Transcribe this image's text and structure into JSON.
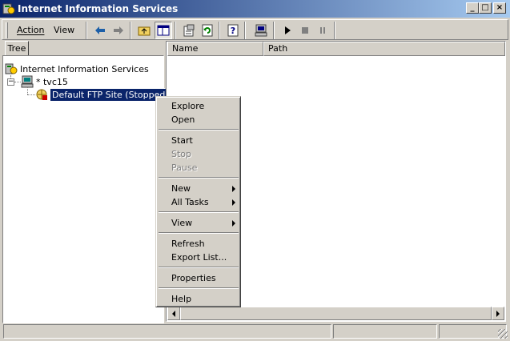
{
  "window": {
    "title": "Internet Information Services"
  },
  "caption_buttons": {
    "minimize": "_",
    "maximize": "□",
    "close": "×"
  },
  "menu": {
    "action": "Action",
    "view": "View"
  },
  "toolbar_icons": [
    "back-icon",
    "forward-icon",
    "up-folder-icon",
    "show-hide-tree-icon",
    "properties-icon",
    "refresh-icon",
    "help-icon",
    "computer-icon",
    "play-icon",
    "stop-icon",
    "pause-icon"
  ],
  "tree": {
    "tab_label": "Tree",
    "root_label": "Internet Information Services",
    "server_label": "* tvc15",
    "site_label": "Default FTP Site (Stopped)"
  },
  "list": {
    "columns": [
      "Name",
      "Path"
    ]
  },
  "context_menu": {
    "explore": "Explore",
    "open": "Open",
    "start": "Start",
    "stop": "Stop",
    "pause": "Pause",
    "new": "New",
    "all_tasks": "All Tasks",
    "view": "View",
    "refresh": "Refresh",
    "export_list": "Export List...",
    "properties": "Properties",
    "help": "Help"
  },
  "colors": {
    "titlebar_start": "#0a246a",
    "titlebar_end": "#a6caf0",
    "selection": "#0a246a",
    "face": "#d4d0c8"
  }
}
